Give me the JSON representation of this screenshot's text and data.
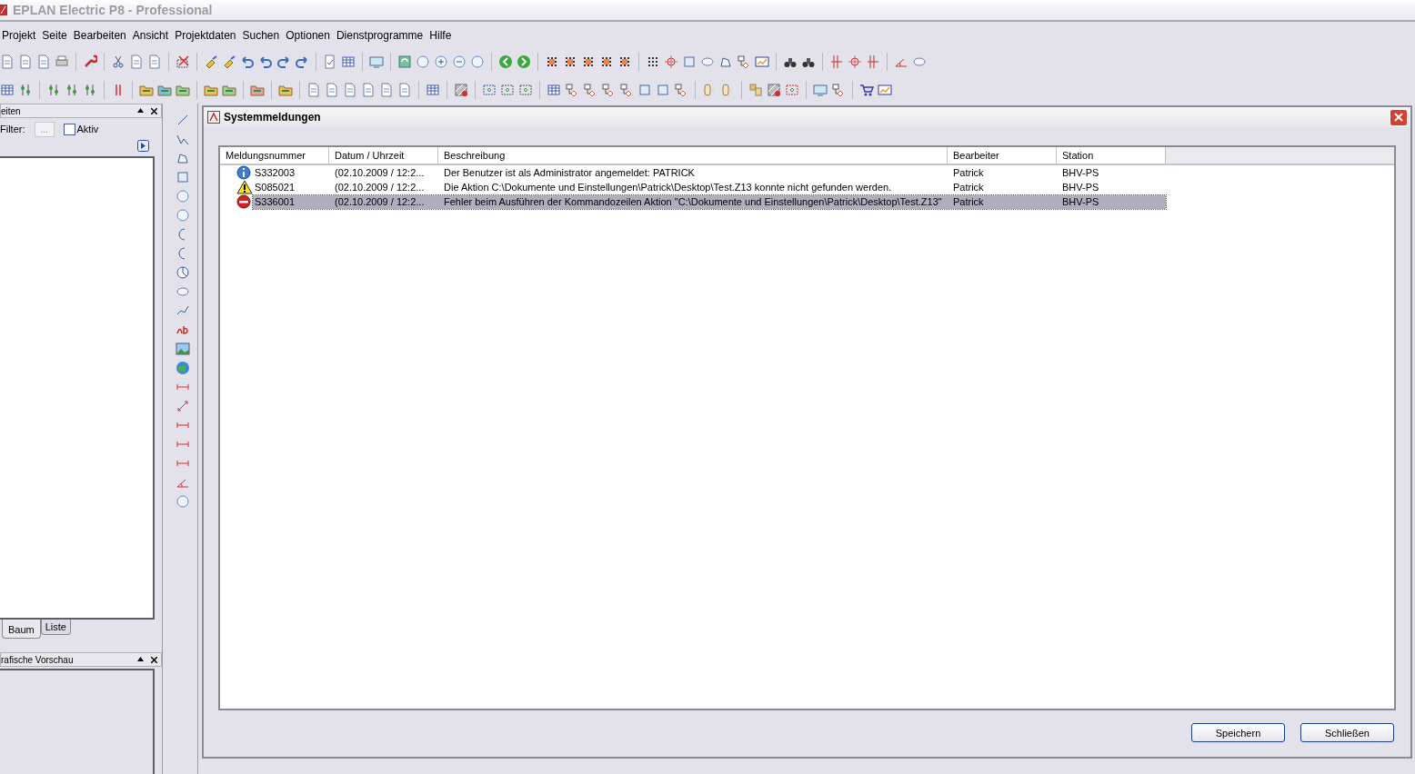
{
  "window": {
    "title": "EPLAN Electric P8 - Professional"
  },
  "menu": [
    "Projekt",
    "Seite",
    "Bearbeiten",
    "Ansicht",
    "Projektdaten",
    "Suchen",
    "Optionen",
    "Dienstprogramme",
    "Hilfe"
  ],
  "pages_panel": {
    "title": "eiten",
    "filter_label": "Filter:",
    "filter_button": "...",
    "aktiv": {
      "label": "Aktiv",
      "checked": false
    },
    "tabs": [
      {
        "label": "Baum",
        "selected": true
      },
      {
        "label": "Liste",
        "selected": false
      }
    ]
  },
  "preview_panel": {
    "title": "rafische Vorschau"
  },
  "dialog": {
    "title": "Systemmeldungen",
    "columns": [
      "Meldungsnummer",
      "Datum / Uhrzeit",
      "Beschreibung",
      "Bearbeiter",
      "Station"
    ],
    "rows": [
      {
        "kind": "info",
        "selected": false,
        "cells": [
          "S332003",
          "(02.10.2009 / 12:2...",
          "Der Benutzer ist als Administrator angemeldet: PATRICK",
          "Patrick",
          "BHV-PS"
        ]
      },
      {
        "kind": "warning",
        "selected": false,
        "cells": [
          "S085021",
          "(02.10.2009 / 12:2...",
          "Die Aktion C:\\Dokumente und Einstellungen\\Patrick\\Desktop\\Test.Z13 konnte nicht gefunden werden.",
          "Patrick",
          "BHV-PS"
        ]
      },
      {
        "kind": "error",
        "selected": true,
        "cells": [
          "S336001",
          "(02.10.2009 / 12:2...",
          "Fehler beim Ausführen der Kommandozeilen Aktion \"C:\\Dokumente und Einstellungen\\Patrick\\Desktop\\Test.Z13\"",
          "Patrick",
          "BHV-PS"
        ]
      }
    ],
    "buttons": [
      "Speichern",
      "Schließen"
    ]
  }
}
